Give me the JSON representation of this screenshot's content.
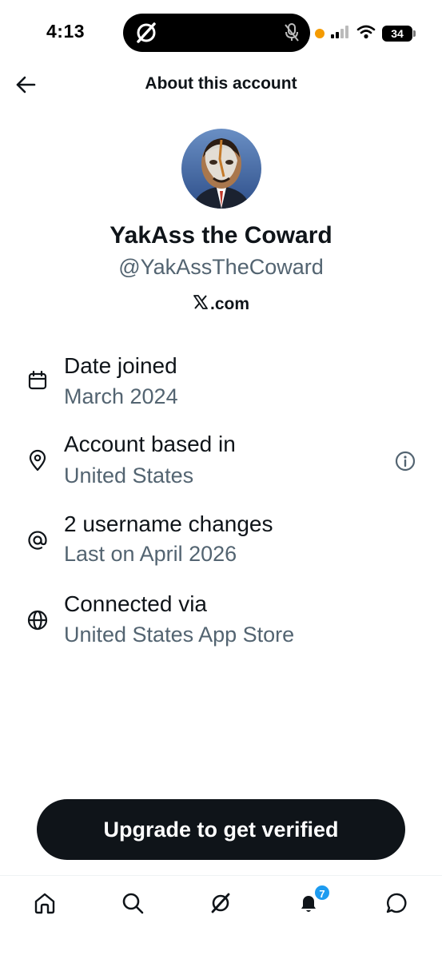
{
  "status_bar": {
    "time": "4:13",
    "battery": "34",
    "colors": {
      "recording_dot": "#f59b00"
    },
    "icons": [
      "x-logo-icon",
      "mic-off-icon",
      "signal-icon",
      "wifi-icon",
      "battery-icon"
    ]
  },
  "header": {
    "title": "About this account",
    "back_icon": "arrow-left-icon"
  },
  "profile": {
    "avatar": "avatar-photo",
    "display_name": "YakAss the Coward",
    "handle": "@YakAssTheCoward",
    "site": ".com",
    "site_logo": "x-logo-icon"
  },
  "info": [
    {
      "icon": "calendar-icon",
      "title": "Date joined",
      "value": "March 2024"
    },
    {
      "icon": "location-pin-icon",
      "title": "Account based in",
      "value": "United States",
      "action_icon": "info-icon"
    },
    {
      "icon": "at-sign-icon",
      "title": "2 username changes",
      "value": "Last on April 2026"
    },
    {
      "icon": "globe-icon",
      "title": "Connected via",
      "value": "United States App Store"
    }
  ],
  "cta": {
    "label": "Upgrade to get verified"
  },
  "bottom_nav": {
    "items": [
      "home-icon",
      "search-icon",
      "grok-icon",
      "notifications-icon",
      "messages-icon"
    ],
    "notification_badge": "7",
    "colors": {
      "badge": "#1d9bf0"
    }
  },
  "colors": {
    "primary_text": "#0f1419",
    "secondary_text": "#536471",
    "button_bg": "#0f1419"
  }
}
